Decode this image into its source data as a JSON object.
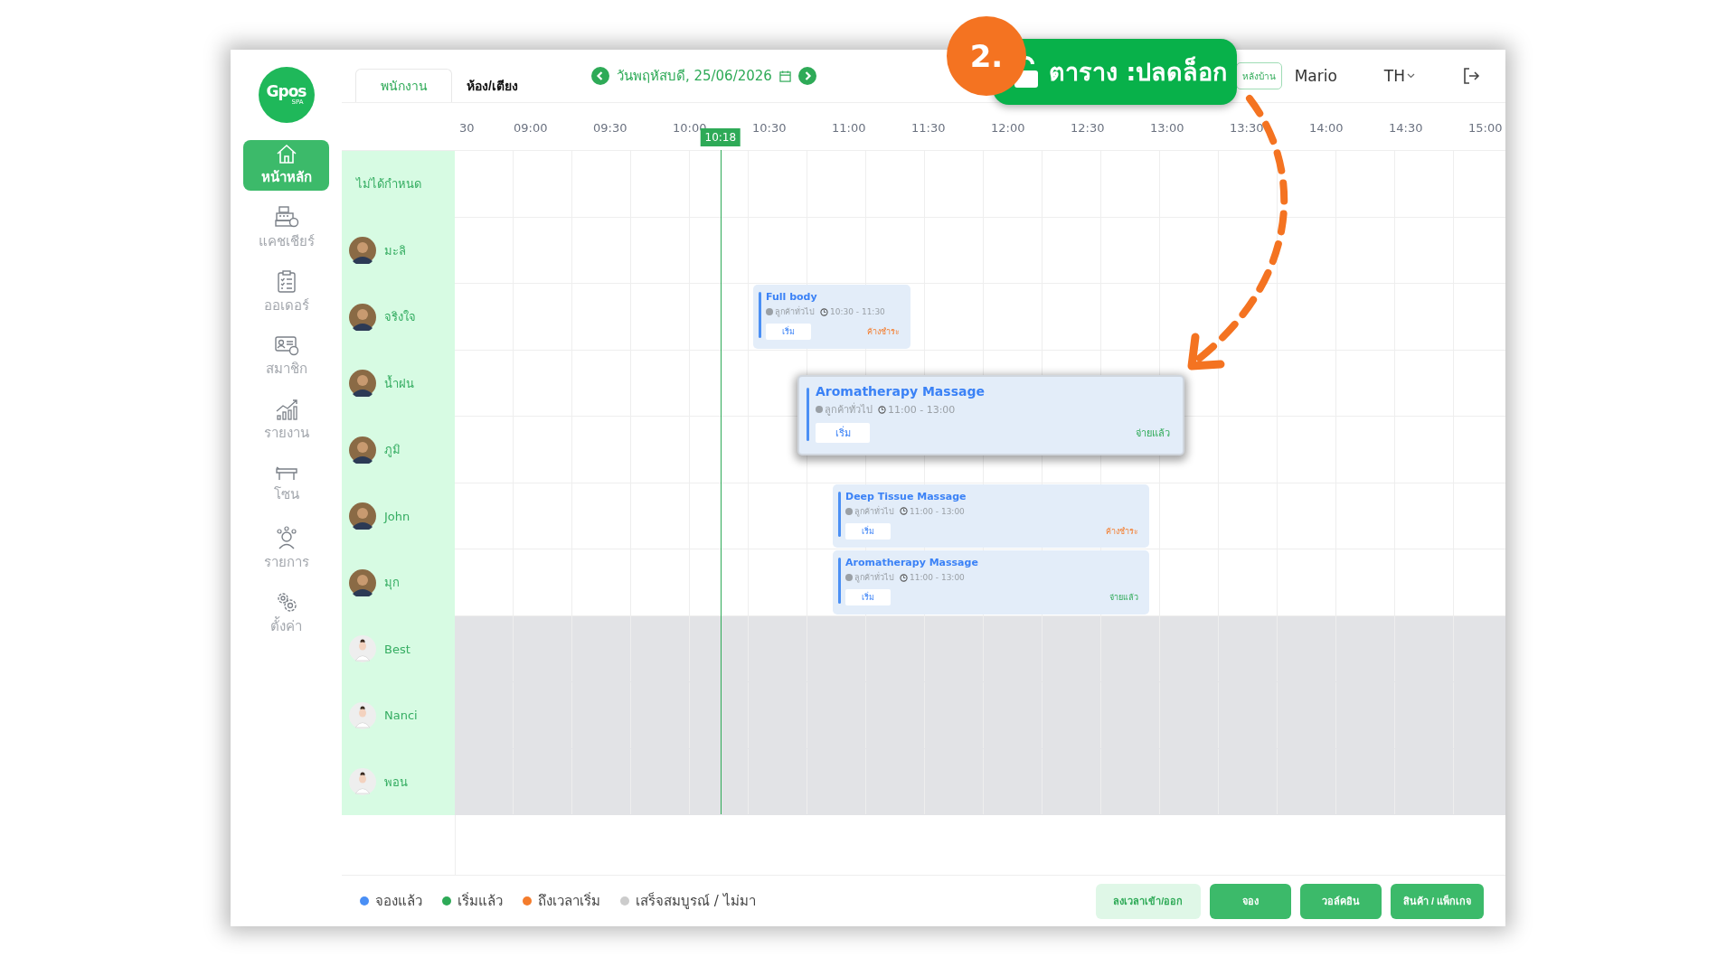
{
  "sidebar": {
    "logo": {
      "name": "Gpos",
      "sub": "SPA"
    },
    "items": [
      {
        "label": "หน้าหลัก",
        "kind": "home",
        "selected": true
      },
      {
        "label": "แคชเชียร์",
        "kind": "cashier",
        "selected": false
      },
      {
        "label": "ออเดอร์",
        "kind": "orders",
        "selected": false
      },
      {
        "label": "สมาชิก",
        "kind": "members",
        "selected": false
      },
      {
        "label": "รายงาน",
        "kind": "reports",
        "selected": false
      },
      {
        "label": "โซน",
        "kind": "zones",
        "selected": false
      },
      {
        "label": "รายการ",
        "kind": "services",
        "selected": false
      },
      {
        "label": "ตั้งค่า",
        "kind": "settings",
        "selected": false
      }
    ]
  },
  "tabs": [
    {
      "label": "พนักงาน",
      "selected": true
    },
    {
      "label": "ห้อง/เตียง",
      "selected": false
    }
  ],
  "date_nav": {
    "date": "วันพฤหัสบดี, 25/06/2026"
  },
  "header": {
    "backoffice_button": "หลังบ้าน",
    "user": "Mario",
    "language": "TH"
  },
  "schedule": {
    "time_slots": [
      "30",
      "09:00",
      "09:30",
      "10:00",
      "10:30",
      "11:00",
      "11:30",
      "12:00",
      "12:30",
      "13:00",
      "13:30",
      "14:00",
      "14:30",
      "15:00"
    ],
    "now": "10:18",
    "unassigned_label": "ไม่ได้กำหนด",
    "staff": [
      {
        "name": "มะลิ",
        "kind": "photo",
        "off": false
      },
      {
        "name": "จริงใจ",
        "kind": "photo",
        "off": false,
        "bookings": [
          {
            "service": "Full body",
            "customer": "ลูกค้าทั่วไป",
            "time": "10:30 - 11:30",
            "start_button": "เริ่ม",
            "payment": "ค้างชำระ",
            "paid": false
          }
        ]
      },
      {
        "name": "น้ำฝน",
        "kind": "photo",
        "off": false
      },
      {
        "name": "ภูมิ",
        "kind": "photo",
        "off": false
      },
      {
        "name": "John",
        "kind": "photo",
        "off": false,
        "bookings": [
          {
            "service": "Deep Tissue Massage",
            "customer": "ลูกค้าทั่วไป",
            "time": "11:00 - 13:00",
            "start_button": "เริ่ม",
            "payment": "ค้างชำระ",
            "paid": false
          }
        ]
      },
      {
        "name": "มุก",
        "kind": "photo",
        "off": false,
        "bookings": [
          {
            "service": "Aromatherapy Massage",
            "customer": "ลูกค้าทั่วไป",
            "time": "11:00 - 13:00",
            "start_button": "เริ่ม",
            "payment": "จ่ายแล้ว",
            "paid": true
          }
        ]
      },
      {
        "name": "Best",
        "kind": "default",
        "off": true
      },
      {
        "name": "Nanci",
        "kind": "default",
        "off": true
      },
      {
        "name": "พอน",
        "kind": "default",
        "off": true
      }
    ]
  },
  "dragged_booking": {
    "service": "Aromatherapy Massage",
    "customer": "ลูกค้าทั่วไป",
    "time": "11:00 - 13:00",
    "start_button": "เริ่ม",
    "payment": "จ่ายแล้ว",
    "paid": true
  },
  "legend": [
    {
      "label": "จองแล้ว",
      "color": "#4a8ff5"
    },
    {
      "label": "เริ่มแล้ว",
      "color": "#2eaa57"
    },
    {
      "label": "ถึงเวลาเริ่ม",
      "color": "#f47c2c"
    },
    {
      "label": "เสร็จสมบูรณ์ / ไม่มา",
      "color": "#cccccc"
    }
  ],
  "actions": [
    {
      "label": "ลงเวลาเข้า/ออก",
      "kind": "secondary"
    },
    {
      "label": "จอง",
      "kind": "primary"
    },
    {
      "label": "วอล์คอิน",
      "kind": "primary"
    },
    {
      "label": "สินค้า / แพ็กเกจ",
      "kind": "primary"
    }
  ],
  "callout": {
    "number": "2.",
    "text": "ตาราง :ปลดล็อก"
  }
}
